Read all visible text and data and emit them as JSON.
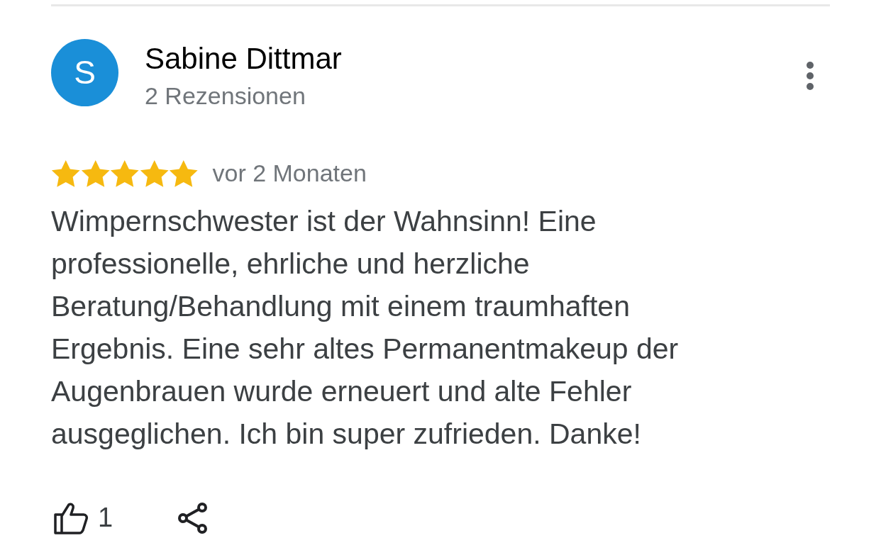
{
  "review": {
    "avatar_letter": "S",
    "author": "Sabine Dittmar",
    "review_count": "2 Rezensionen",
    "stars": 5,
    "time": "vor 2 Monaten",
    "text": "Wimpernschwester ist der Wahnsinn! Eine professionelle, ehrliche und herzliche Beratung/Behandlung mit einem traumhaften Ergebnis. Eine sehr altes Permanentmakeup der Augenbrauen wurde erneuert und alte Fehler ausgeglichen. Ich bin super zufrieden. Danke!",
    "likes": "1"
  }
}
